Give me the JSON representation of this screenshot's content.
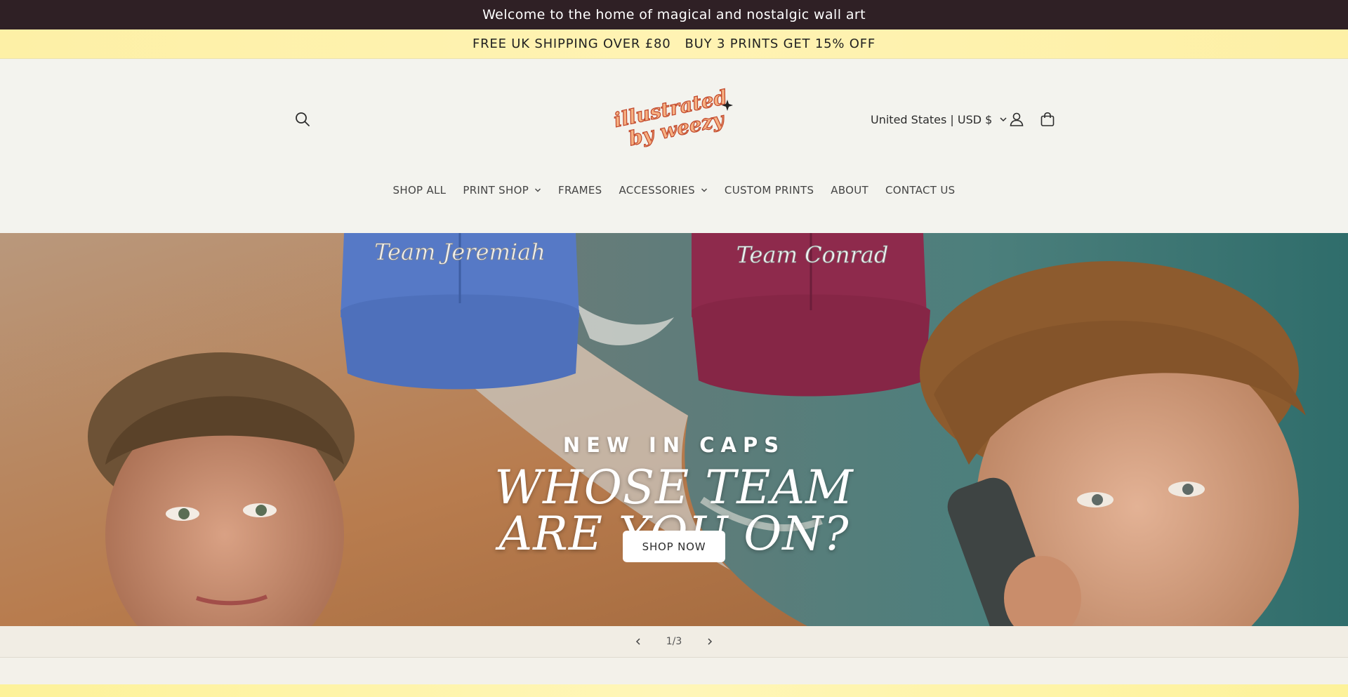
{
  "announcement": {
    "text": "Welcome to the home of magical and nostalgic wall art"
  },
  "promo": {
    "shipping": "FREE UK SHIPPING OVER £80",
    "offer": "BUY 3 PRINTS GET 15% OFF"
  },
  "header": {
    "logo_line1": "illustrated",
    "logo_line2": "by weezy",
    "locale": "United States | USD $"
  },
  "nav": {
    "items": [
      {
        "label": "SHOP ALL"
      },
      {
        "label": "PRINT SHOP"
      },
      {
        "label": "FRAMES"
      },
      {
        "label": "ACCESSORIES"
      },
      {
        "label": "CUSTOM PRINTS"
      },
      {
        "label": "ABOUT"
      },
      {
        "label": "CONTACT US"
      }
    ]
  },
  "hero": {
    "cap_left_text": "Team Jeremiah",
    "cap_right_text": "Team Conrad",
    "subtitle": "NEW IN CAPS",
    "title_line1": "WHOSE TEAM",
    "title_line2": "ARE YOU ON?",
    "cta": "SHOP NOW"
  },
  "slider": {
    "counter": "1/3",
    "current": 1,
    "total": 3
  },
  "colors": {
    "topbar": "#2f2025",
    "promo": "#fff3b3",
    "header_bg": "#f3f3ee",
    "logo_orange": "#f4a36b",
    "cap_blue": "#5679c6",
    "cap_red": "#8e2a4c"
  }
}
